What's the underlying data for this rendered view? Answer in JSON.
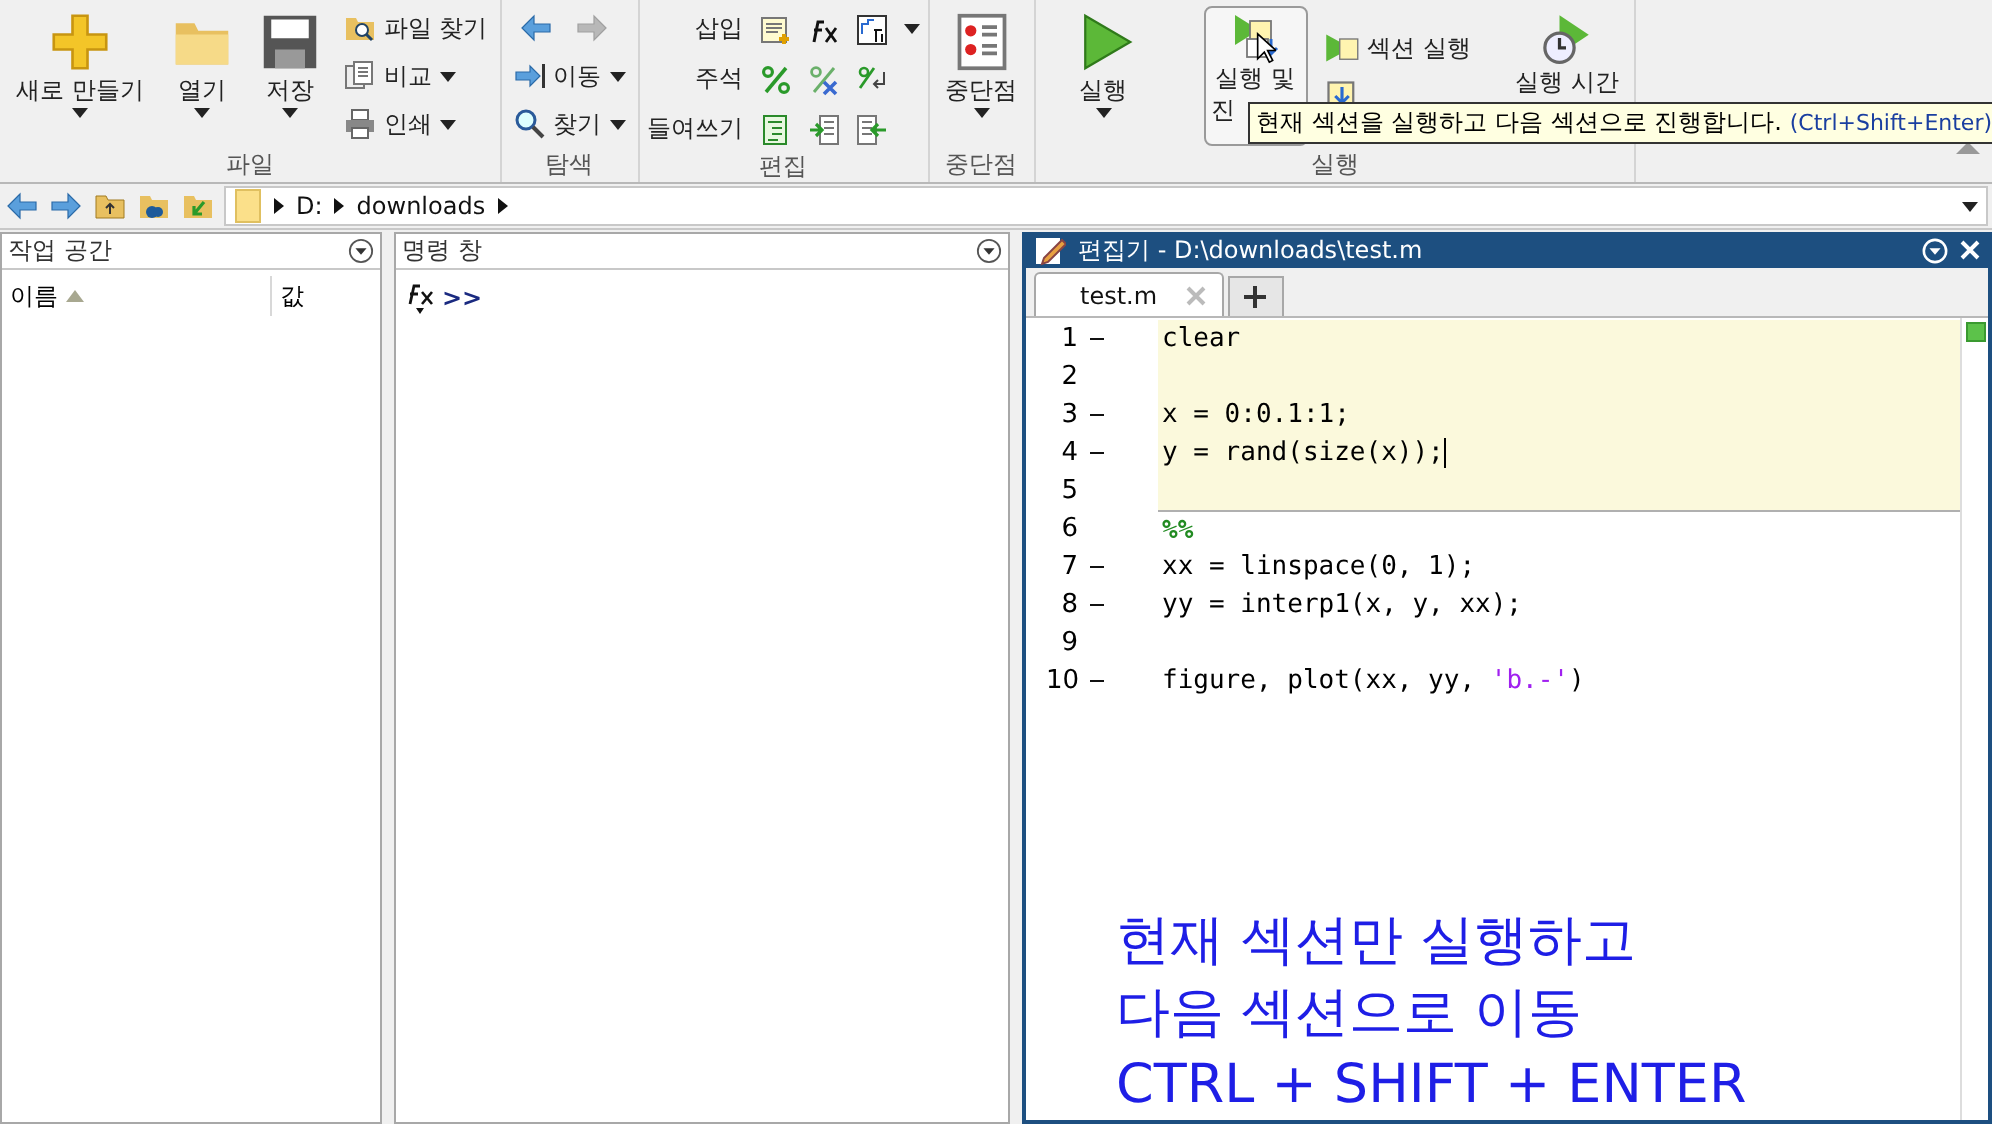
{
  "ribbon": {
    "groups": [
      {
        "kind": "file",
        "label": "파일",
        "big": [
          {
            "label": "새로 만들기"
          },
          {
            "label": "열기"
          },
          {
            "label": "저장"
          }
        ],
        "small": [
          {
            "label": "파일 찾기",
            "caret": false
          },
          {
            "label": "비교",
            "caret": true
          },
          {
            "label": "인쇄",
            "caret": true
          }
        ]
      },
      {
        "kind": "navigate",
        "label": "탐색",
        "arrows": [
          {
            "disabled": false
          },
          {
            "disabled": true
          }
        ],
        "small": [
          {
            "label": "이동",
            "caret": true
          },
          {
            "label": "찾기",
            "caret": true
          }
        ]
      },
      {
        "kind": "edit",
        "label": "편집",
        "rows": [
          {
            "label": "삽입",
            "caret": true
          },
          {
            "label": "주석",
            "caret": false
          },
          {
            "label": "들여쓰기",
            "caret": false
          }
        ]
      },
      {
        "kind": "breakpoints",
        "label": "중단점",
        "big": [
          {
            "label": "중단점"
          }
        ]
      },
      {
        "kind": "run",
        "label": "실행",
        "big": [
          {
            "label": "실행",
            "caret": true,
            "hovered": false
          },
          {
            "label": "실행 및",
            "label2": "진",
            "caret": false,
            "hovered": true
          }
        ],
        "small": [
          {
            "label": "섹션 실행"
          }
        ],
        "timed": {
          "label": "실행 시간"
        }
      }
    ]
  },
  "tooltip": {
    "text": "현재 섹션을 실행하고 다음 섹션으로 진행합니다.",
    "shortcut": "(Ctrl+Shift+Enter)"
  },
  "address_bar": {
    "path": [
      "D:",
      "downloads"
    ]
  },
  "workspace": {
    "title": "작업 공간",
    "columns": [
      {
        "label": "이름",
        "sorted": true
      },
      {
        "label": "값",
        "sorted": false
      }
    ]
  },
  "command_window": {
    "title": "명령 창",
    "prompt": ">>"
  },
  "editor": {
    "title": "편집기 - D:\\downloads\\test.m",
    "tabs": [
      {
        "label": "test.m",
        "selected": true
      }
    ],
    "lines": [
      {
        "number": "1",
        "executable": true,
        "current_section": true,
        "tokens": [
          {
            "kind": "code",
            "text": "clear"
          }
        ]
      },
      {
        "number": "2",
        "executable": false,
        "current_section": true
      },
      {
        "number": "3",
        "executable": true,
        "current_section": true,
        "tokens": [
          {
            "kind": "code",
            "text": "x = 0:0.1:1;"
          }
        ]
      },
      {
        "number": "4",
        "executable": true,
        "current_section": true,
        "cursor": true,
        "tokens": [
          {
            "kind": "code",
            "text": "y = rand(size(x));"
          }
        ]
      },
      {
        "number": "5",
        "executable": false,
        "current_section": true
      },
      {
        "number": "6",
        "executable": false,
        "current_section": false,
        "section_break": true,
        "tokens": [
          {
            "kind": "section",
            "text": "%%"
          }
        ]
      },
      {
        "number": "7",
        "executable": true,
        "current_section": false,
        "tokens": [
          {
            "kind": "code",
            "text": "xx = linspace(0, 1);"
          }
        ]
      },
      {
        "number": "8",
        "executable": true,
        "current_section": false,
        "tokens": [
          {
            "kind": "code",
            "text": "yy = interp1(x, y, xx);"
          }
        ]
      },
      {
        "number": "9",
        "executable": false,
        "current_section": false
      },
      {
        "number": "10",
        "executable": true,
        "current_section": false,
        "tokens": [
          {
            "kind": "code",
            "text": "figure, plot(xx, yy, "
          },
          {
            "kind": "string",
            "text": "'b.-'"
          },
          {
            "kind": "code",
            "text": ")"
          }
        ]
      }
    ]
  },
  "caption": [
    "현재 섹션만 실행하고",
    "다음 섹션으로 이동",
    "CTRL + SHIFT + ENTER"
  ]
}
